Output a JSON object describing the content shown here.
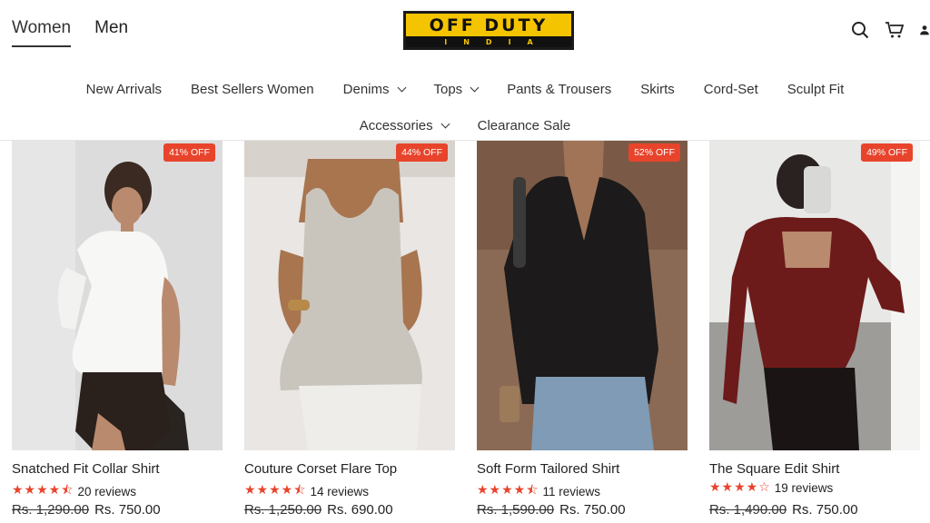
{
  "header": {
    "gender_tabs": [
      {
        "label": "Women",
        "active": true
      },
      {
        "label": "Men",
        "active": false
      }
    ],
    "logo": {
      "main": "OFF DUTY",
      "sub": "INDIA"
    },
    "icons": [
      "search-icon",
      "cart-icon",
      "account-icon"
    ]
  },
  "nav": {
    "row1": [
      {
        "label": "New Arrivals"
      },
      {
        "label": "Best Sellers Women"
      },
      {
        "label": "Denims"
      },
      {
        "label": "Tops"
      },
      {
        "label": "Pants & Trousers"
      },
      {
        "label": "Skirts"
      },
      {
        "label": "Cord-Set"
      },
      {
        "label": "Sculpt Fit"
      }
    ],
    "row2": [
      {
        "label": "Accessories"
      },
      {
        "label": "Clearance Sale"
      }
    ]
  },
  "products": [
    {
      "badge": "41% OFF",
      "title": "Snatched Fit Collar Shirt",
      "stars": "★★★★⯪",
      "reviews": "20 reviews",
      "old_price": "Rs. 1,290.00",
      "price": "Rs. 750.00"
    },
    {
      "badge": "44% OFF",
      "title": "Couture Corset Flare Top",
      "stars": "★★★★⯪",
      "reviews": "14 reviews",
      "old_price": "Rs. 1,250.00",
      "price": "Rs. 690.00"
    },
    {
      "badge": "52% OFF",
      "title": "Soft Form Tailored Shirt",
      "stars": "★★★★⯪",
      "reviews": "11 reviews",
      "old_price": "Rs. 1,590.00",
      "price": "Rs. 750.00"
    },
    {
      "badge": "49% OFF",
      "title": "The Square Edit Shirt",
      "stars": "★★★★☆",
      "reviews": "19 reviews",
      "old_price": "Rs. 1,490.00",
      "price": "Rs. 750.00"
    }
  ],
  "colors": {
    "accent": "#e8442c",
    "logo_yellow": "#f5c400"
  }
}
